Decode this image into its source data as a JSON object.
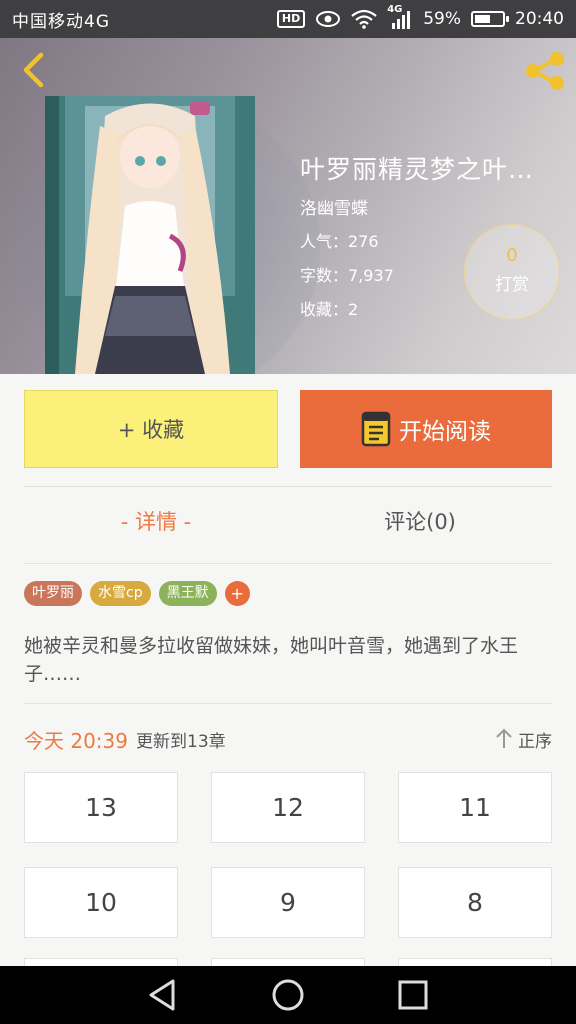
{
  "status_bar": {
    "carrier": "中国移动4G",
    "hd": "HD",
    "network": "4G",
    "battery_percent": "59%",
    "battery_level": 0.59,
    "time": "20:40"
  },
  "header": {
    "back_icon": "chevron-left-icon",
    "share_icon": "share-icon"
  },
  "book": {
    "title": "叶罗丽精灵梦之叶…",
    "author": "洛幽雪蝶",
    "popularity": "人气：276",
    "word_count": "字数：7,937",
    "favorites": "收藏：2",
    "tip_count": "0",
    "tip_label": "打赏"
  },
  "actions": {
    "favorite_label": "+ 收藏",
    "read_label": "开始阅读",
    "read_icon": "book-icon"
  },
  "tabs": {
    "detail": "- 详情 -",
    "comments": "评论(0)"
  },
  "tags": [
    {
      "label": "叶罗丽",
      "color": "#c9765a"
    },
    {
      "label": "水雪cp",
      "color": "#d6aa3e"
    },
    {
      "label": "黑王默",
      "color": "#8db35a"
    }
  ],
  "tag_add": "+",
  "description": "她被辛灵和曼多拉收留做妹妹，她叫叶音雪，她遇到了水王子……",
  "update": {
    "date": "今天 20:39",
    "text": "更新到13章",
    "sort_label": "正序"
  },
  "chapters": [
    "13",
    "12",
    "11",
    "10",
    "9",
    "8"
  ],
  "colors": {
    "accent": "#ea6b3b",
    "favorite_bg": "#fbf17a",
    "orange_text": "#ee7a42"
  }
}
